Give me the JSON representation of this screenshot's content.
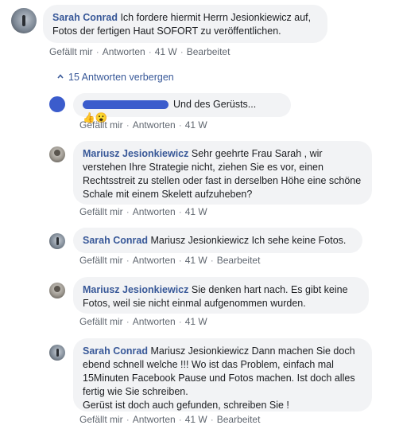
{
  "actions": {
    "like": "Gefällt mir",
    "reply": "Antworten",
    "time": "41 W",
    "edit": "Bearbeitet",
    "sep": "·"
  },
  "toggle": {
    "label": "15 Antworten verbergen"
  },
  "comments": [
    {
      "author": "Sarah Conrad",
      "text": "Ich fordere hiermit Herrn Jesionkiewicz auf, Fotos der fertigen Haut SOFORT zu veröffentlichen.",
      "edited": true
    },
    {
      "author": "",
      "text": "Und des Gerüsts... ",
      "emoji": "👍😮",
      "edited": false
    },
    {
      "author": "Mariusz Jesionkiewicz",
      "text": "Sehr geehrte Frau Sarah , wir verstehen Ihre Strategie nicht, ziehen Sie es vor, einen Rechtsstreit zu stellen oder fast in derselben Höhe eine schöne Schale mit einem Skelett aufzuheben?",
      "edited": false
    },
    {
      "author": "Sarah Conrad",
      "text": "Mariusz Jesionkiewicz Ich sehe keine Fotos.",
      "edited": true
    },
    {
      "author": "Mariusz Jesionkiewicz",
      "text": "Sie denken hart nach. Es gibt keine Fotos, weil sie nicht einmal aufgenommen wurden.",
      "edited": false
    },
    {
      "author": "Sarah Conrad",
      "text": "Mariusz Jesionkiewicz Dann machen Sie doch ebend schnell welche !!! Wo ist das Problem, einfach mal 15Minuten Facebook Pause und Fotos machen. Ist doch alles fertig wie Sie schreiben.",
      "text2": "Gerüst ist doch auch gefunden, schreiben Sie !",
      "edited": true
    }
  ]
}
